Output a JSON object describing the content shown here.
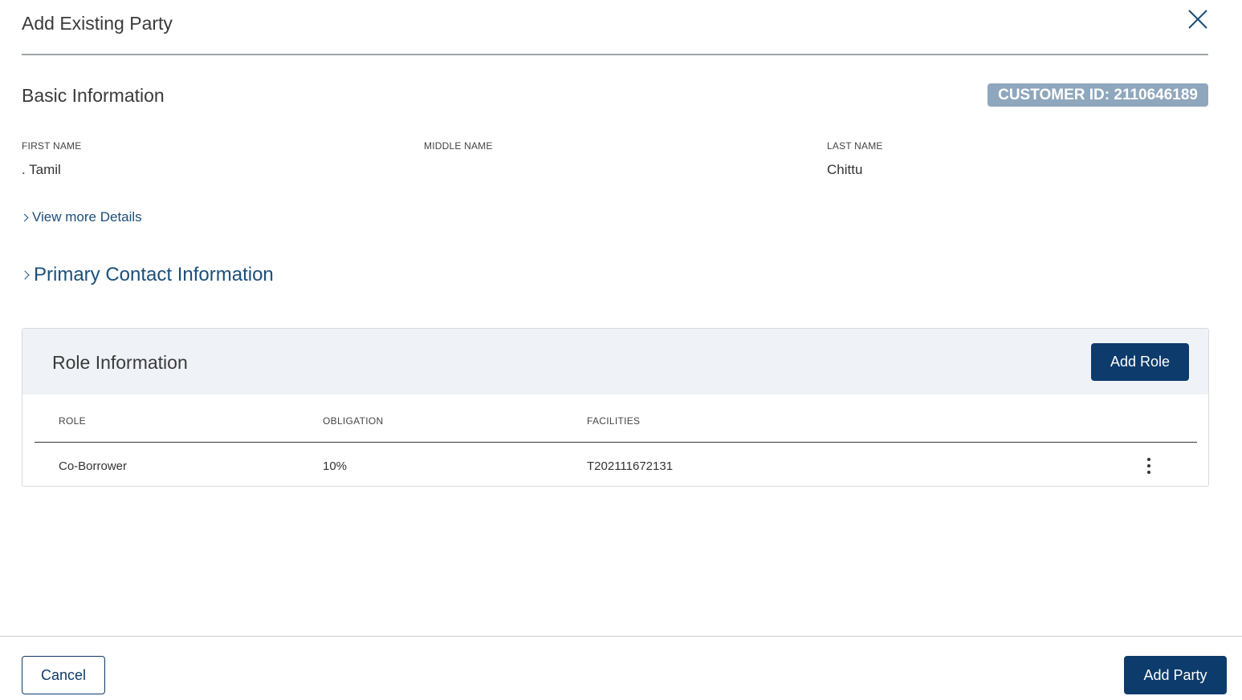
{
  "modal": {
    "title": "Add Existing Party"
  },
  "basic_info": {
    "title": "Basic Information",
    "customer_id_badge": "CUSTOMER ID: 2110646189",
    "fields": [
      {
        "label": "FIRST NAME",
        "value": ". Tamil"
      },
      {
        "label": "MIDDLE NAME",
        "value": ""
      },
      {
        "label": "LAST NAME",
        "value": "Chittu"
      }
    ],
    "view_more_link": "View more Details"
  },
  "primary_contact": {
    "label": "Primary Contact Information"
  },
  "role_info": {
    "title": "Role Information",
    "add_role_label": "Add Role",
    "columns": [
      "ROLE",
      "OBLIGATION",
      "FACILITIES"
    ],
    "rows": [
      {
        "role": "Co-Borrower",
        "obligation": "10%",
        "facilities": "T202111672131"
      }
    ]
  },
  "footer": {
    "cancel_label": "Cancel",
    "add_party_label": "Add Party"
  },
  "colors": {
    "primary": "#0d3b6b",
    "badge": "#8fa7bd",
    "link": "#1b4f7a",
    "panel_header": "#eff3f7"
  }
}
